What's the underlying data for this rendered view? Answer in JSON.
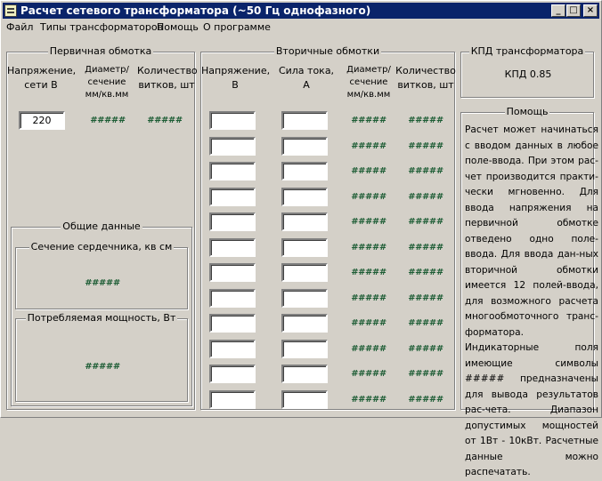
{
  "window": {
    "title": "Расчет сетевого трансформатора (~50 Гц однофазного)",
    "min_glyph": "_",
    "max_glyph": "□",
    "close_glyph": "×"
  },
  "menu": [
    "Файл",
    "Типы трансформаторов",
    "Помощь",
    "О программе"
  ],
  "primary": {
    "title": "Первичная обмотка",
    "col_voltage": "Напряжение,\nсети В",
    "col_diameter": "Диаметр/\nсечение\nмм/кв.мм",
    "col_turns": "Количество\nвитков, шт",
    "voltage_value": "220",
    "diameter_value": "#####",
    "turns_value": "#####"
  },
  "general": {
    "title": "Общие данные",
    "core_title": "Сечение сердечника, кв см",
    "core_value": "#####",
    "power_title": "Потребляемая мощность, Вт",
    "power_value": "#####"
  },
  "secondary": {
    "title": "Вторичные обмотки",
    "col_voltage": "Напряжение,\nВ",
    "col_current": "Сила тока,\nА",
    "col_diameter": "Диаметр/\nсечение\nмм/кв.мм",
    "col_turns": "Количество\nвитков, шт",
    "rows": [
      {
        "voltage": "",
        "current": "",
        "diameter": "#####",
        "turns": "#####"
      },
      {
        "voltage": "",
        "current": "",
        "diameter": "#####",
        "turns": "#####"
      },
      {
        "voltage": "",
        "current": "",
        "diameter": "#####",
        "turns": "#####"
      },
      {
        "voltage": "",
        "current": "",
        "diameter": "#####",
        "turns": "#####"
      },
      {
        "voltage": "",
        "current": "",
        "diameter": "#####",
        "turns": "#####"
      },
      {
        "voltage": "",
        "current": "",
        "diameter": "#####",
        "turns": "#####"
      },
      {
        "voltage": "",
        "current": "",
        "diameter": "#####",
        "turns": "#####"
      },
      {
        "voltage": "",
        "current": "",
        "diameter": "#####",
        "turns": "#####"
      },
      {
        "voltage": "",
        "current": "",
        "diameter": "#####",
        "turns": "#####"
      },
      {
        "voltage": "",
        "current": "",
        "diameter": "#####",
        "turns": "#####"
      },
      {
        "voltage": "",
        "current": "",
        "diameter": "#####",
        "turns": "#####"
      },
      {
        "voltage": "",
        "current": "",
        "diameter": "#####",
        "turns": "#####"
      }
    ]
  },
  "efficiency": {
    "title": "КПД трансформатора",
    "value": "КПД 0.85"
  },
  "help": {
    "title": "Помощь",
    "text": "Расчет может начинаться с вводом данных в любое поле-ввода. При этом рас-чет производится практи-чески мгновенно. Для ввода напряжения на первичной обмотке отведено одно поле-ввода. Для ввода дан-ных вторичной обмотки имеется 12 полей-ввода, для возможного расчета многообмоточного транс-форматора. Индикаторные поля имеющие символы ##### предназначены для вывода результатов рас-чета. Диапазон допустимых мощностей от 1Вт - 10кВт. Расчетные данные можно распечатать."
  },
  "colors": {
    "face": "#d4d0c8",
    "titlebar": "#0a246a",
    "indicator": "#1c5c34"
  }
}
